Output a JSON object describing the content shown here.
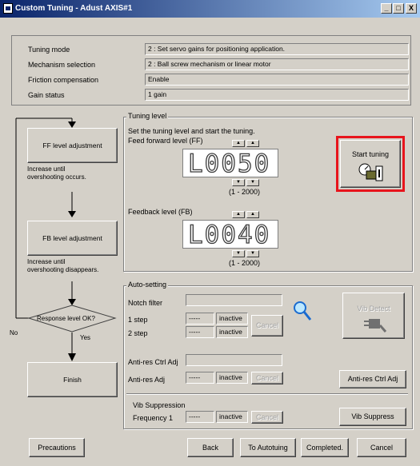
{
  "window": {
    "title": "Custom Tuning - Adust AXIS#1",
    "minimize_glyph": "_",
    "maximize_glyph": "□",
    "close_glyph": "X"
  },
  "info": {
    "rows": [
      {
        "label": "Tuning mode",
        "value": "2 : Set servo gains for positioning application."
      },
      {
        "label": "Mechanism selection",
        "value": "2 : Ball screw mechanism or linear motor"
      },
      {
        "label": "Friction compensation",
        "value": "Enable"
      },
      {
        "label": "Gain status",
        "value": "1 gain"
      }
    ]
  },
  "flow": {
    "ff_box": "FF level adjustment",
    "ff_note_1": "Increase until",
    "ff_note_2": "overshooting occurs.",
    "fb_box": "FB level adjustment",
    "fb_note_1": "Increase until",
    "fb_note_2": "overshooting disappears.",
    "decision": "Response level OK?",
    "no": "No",
    "yes": "Yes",
    "finish": "Finish"
  },
  "tuning_level": {
    "group_label": "Tuning level",
    "instruction": "Set the tuning level and start the tuning.",
    "ff_label": "Feed forward level (FF)",
    "ff_display": "L0050",
    "ff_range": "(1 - 2000)",
    "fb_label": "Feedback level (FB)",
    "fb_display": "L0040",
    "fb_range": "(1 - 2000)",
    "start_button": "Start tuning",
    "highlight_color": "#e8141c"
  },
  "auto_setting": {
    "group_label": "Auto-setting",
    "notch_filter": "Notch filter",
    "step1": "1 step",
    "step2": "2 step",
    "dash": "-----",
    "inactive": "inactive",
    "cancel": "Cancel",
    "vib_detect": "Vib Detect",
    "antires_ctrl_label": "Anti-res Ctrl Adj",
    "antires_label": "Anti-res Adj",
    "antires_button": "Anti-res Ctrl Adj",
    "vib_suppression": "Vib Suppression",
    "frequency1": "Frequency 1",
    "vib_suppress_button": "Vib Suppress"
  },
  "footer": {
    "precautions": "Precautions",
    "back": "Back",
    "to_autotuning": "To Autotuing",
    "completed": "Completed.",
    "cancel": "Cancel"
  }
}
